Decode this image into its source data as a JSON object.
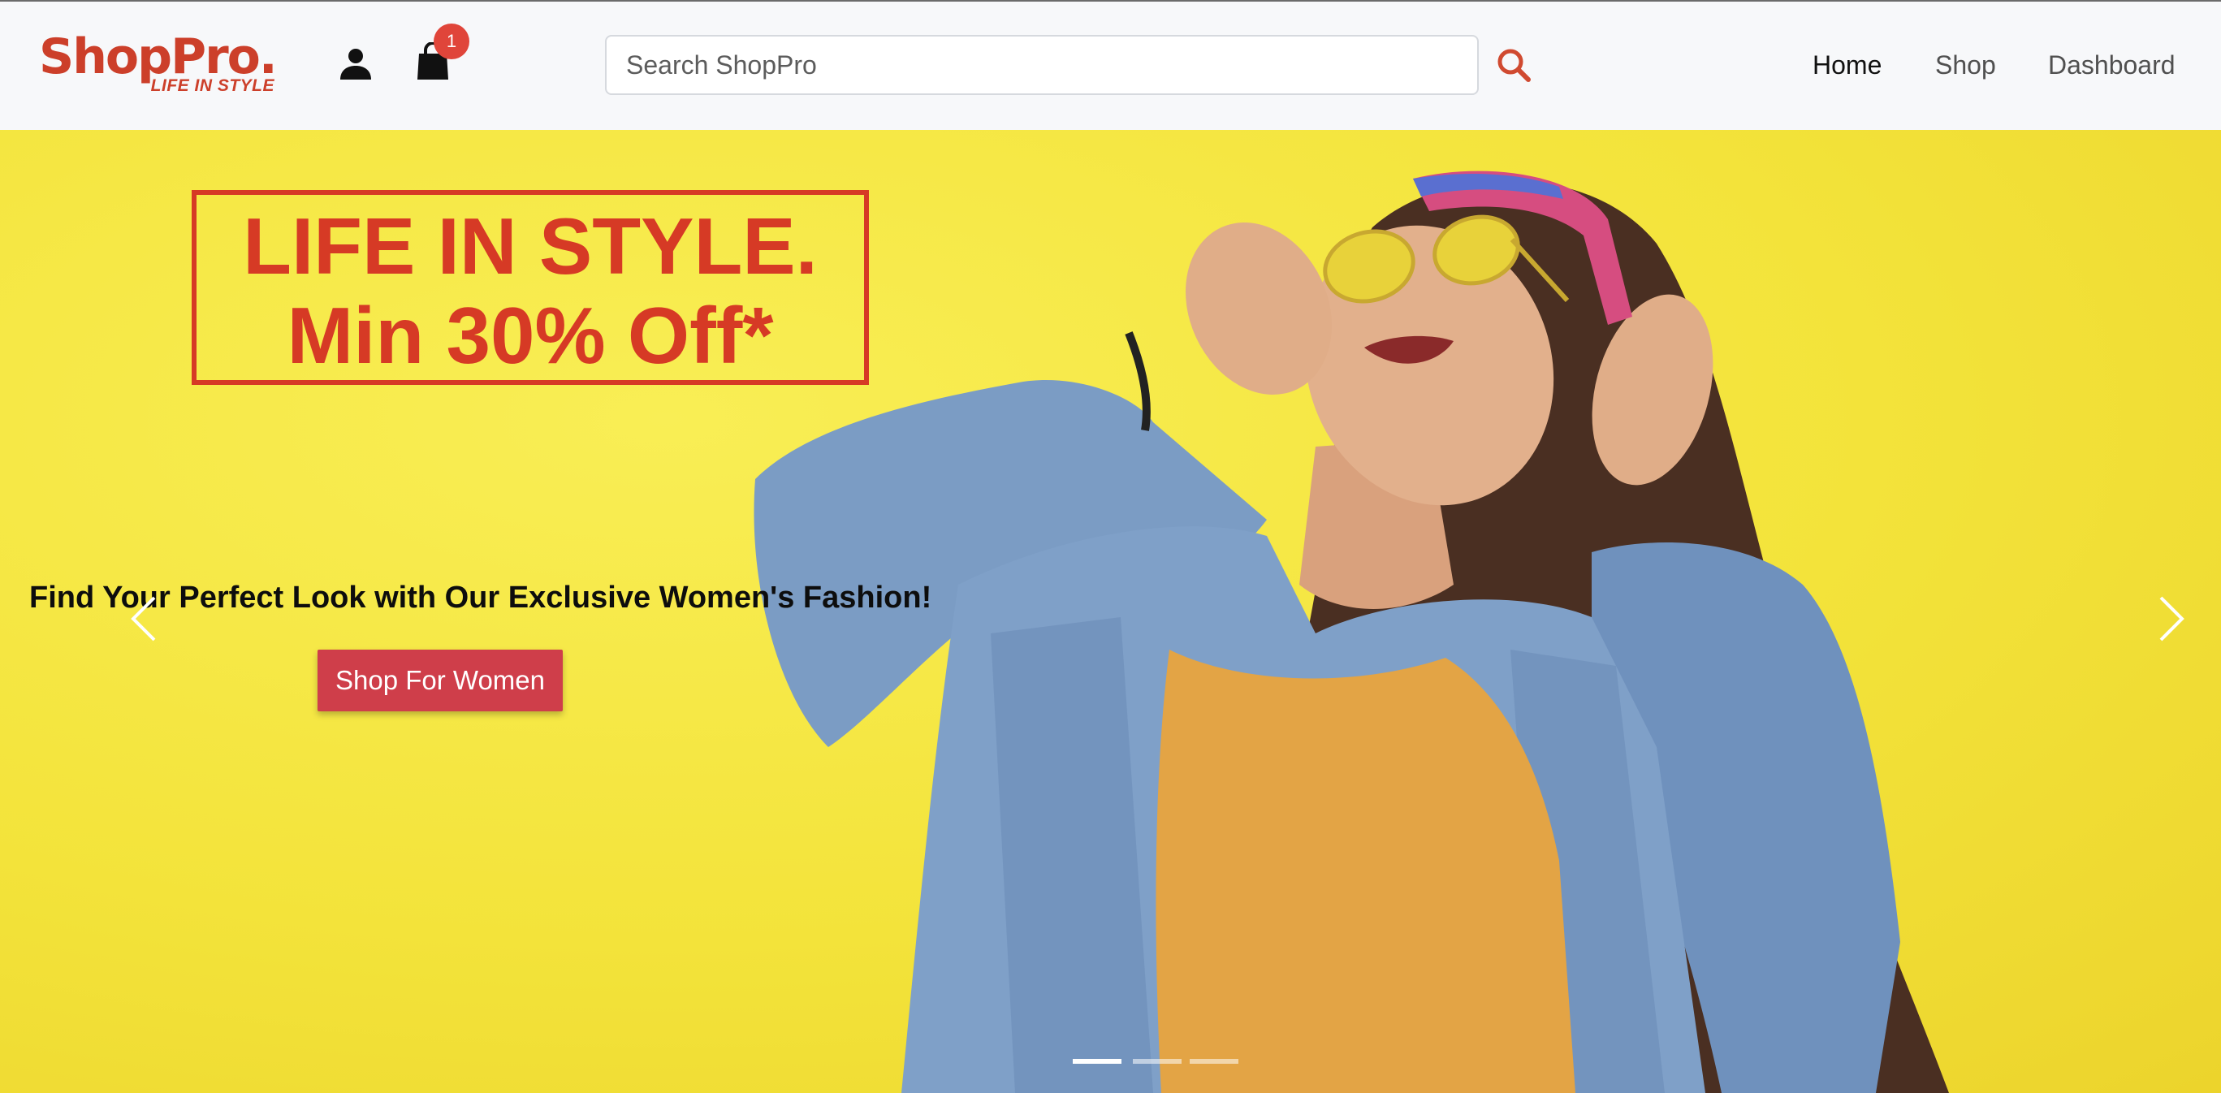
{
  "brand": {
    "name": "ShopPro.",
    "tagline": "LIFE IN STYLE",
    "color": "#cc3f2a"
  },
  "header": {
    "cart_count": "1",
    "search": {
      "placeholder": "Search ShopPro",
      "value": ""
    },
    "nav": [
      {
        "label": "Home",
        "active": true
      },
      {
        "label": "Shop",
        "active": false
      },
      {
        "label": "Dashboard",
        "active": false
      }
    ],
    "icons": [
      "user-icon",
      "shopping-bag-icon",
      "search-icon"
    ]
  },
  "hero": {
    "promo_line1": "LIFE IN STYLE.",
    "promo_line2": "Min 30% Off*",
    "subtitle": "Find Your Perfect Look with Our Exclusive Women's Fashion!",
    "cta_label": "Shop For Women",
    "slide_count": 3,
    "active_slide": 0,
    "colors": {
      "background": "#f3e33a",
      "promo": "#d63a25",
      "cta": "#cf3e4a"
    }
  }
}
